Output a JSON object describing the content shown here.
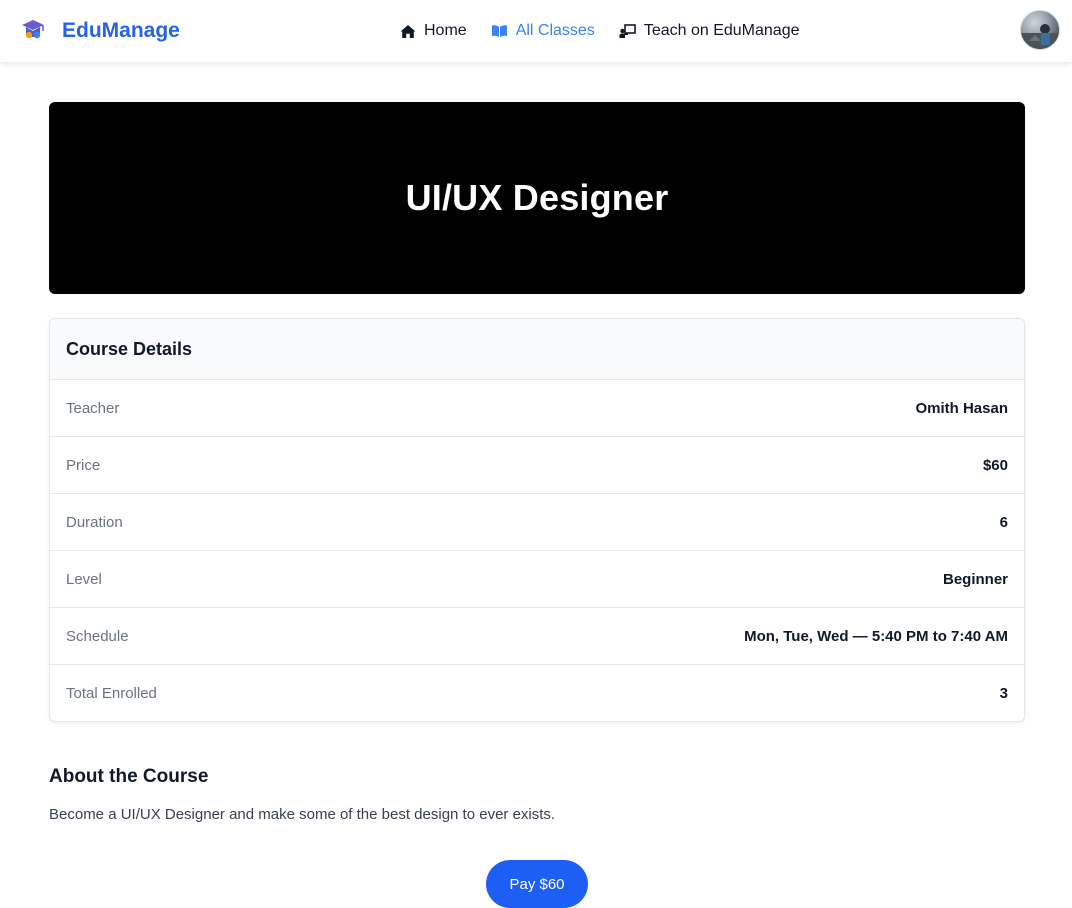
{
  "nav": {
    "brand": "EduManage",
    "links": [
      {
        "label": "Home",
        "icon": "home-icon"
      },
      {
        "label": "All Classes",
        "icon": "book-open-icon",
        "active": true
      },
      {
        "label": "Teach on EduManage",
        "icon": "teacher-board-icon"
      }
    ],
    "avatar_icon": "user-avatar"
  },
  "hero": {
    "title": "UI/UX Designer"
  },
  "details": {
    "heading": "Course Details",
    "rows": [
      {
        "label": "Teacher",
        "value": "Omith Hasan"
      },
      {
        "label": "Price",
        "value": "$60"
      },
      {
        "label": "Duration",
        "value": "6"
      },
      {
        "label": "Level",
        "value": "Beginner"
      },
      {
        "label": "Schedule",
        "value": "Mon, Tue, Wed — 5:40 PM to 7:40 AM"
      },
      {
        "label": "Total Enrolled",
        "value": "3"
      }
    ]
  },
  "about": {
    "title": "About the Course",
    "text": "Become a UI/UX Designer and make some of the best design to ever exists."
  },
  "pay": {
    "label": "Pay $60"
  },
  "colors": {
    "accent": "#2563eb",
    "active_link": "#3b82f6",
    "pay_button": "#1d5ef5",
    "hero_bg": "#000000"
  }
}
